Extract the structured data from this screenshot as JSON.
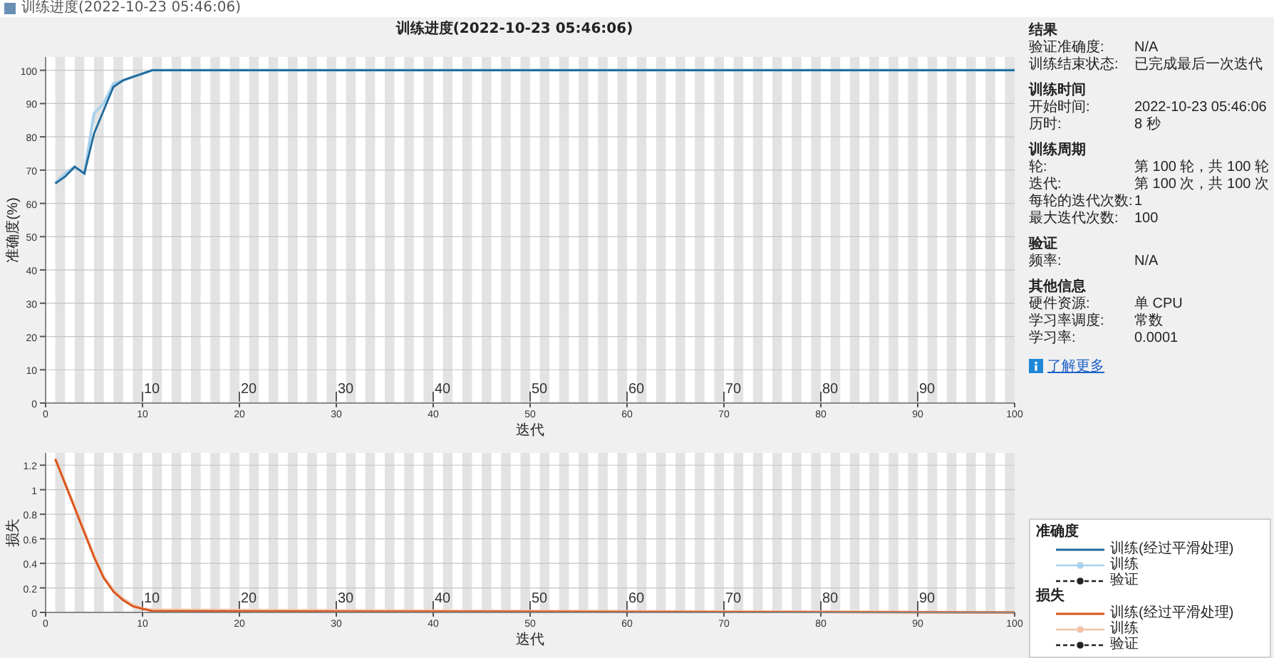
{
  "window": {
    "title": "训练进度(2022-10-23 05:46:06)"
  },
  "heading": "训练进度(2022-10-23 05:46:06)",
  "charts": [
    {
      "chart_data": {
        "type": "line",
        "xlabel": "迭代",
        "ylabel": "准确度(%)",
        "x": [
          1,
          2,
          3,
          4,
          5,
          6,
          7,
          8,
          9,
          10,
          11,
          100
        ],
        "xlim": [
          0,
          100
        ],
        "ylim": [
          0,
          104
        ],
        "xticks": [
          0,
          10,
          20,
          30,
          40,
          50,
          60,
          70,
          80,
          90,
          100
        ],
        "yticks": [
          0,
          10,
          20,
          30,
          40,
          50,
          60,
          70,
          80,
          90,
          100
        ],
        "grid": true,
        "series": [
          {
            "name": "训练(经过平滑处理)",
            "color": "#1f6a9a",
            "values": [
              66,
              68,
              71,
              69,
              81,
              88,
              95,
              97,
              98,
              99,
              100,
              100
            ]
          },
          {
            "name": "训练",
            "color": "#a9d1ec",
            "values": [
              66,
              69,
              71,
              69,
              87,
              90,
              96,
              97,
              98,
              99,
              100,
              100
            ]
          }
        ],
        "annotations": [
          "10",
          "20",
          "30",
          "40",
          "50",
          "60",
          "70",
          "80",
          "90"
        ]
      }
    },
    {
      "chart_data": {
        "type": "line",
        "xlabel": "迭代",
        "ylabel": "损失",
        "x": [
          1,
          2,
          3,
          4,
          5,
          6,
          7,
          8,
          9,
          10,
          11,
          100
        ],
        "xlim": [
          0,
          100
        ],
        "ylim": [
          0,
          1.3
        ],
        "xticks": [
          0,
          10,
          20,
          30,
          40,
          50,
          60,
          70,
          80,
          90,
          100
        ],
        "yticks": [
          0,
          0.2,
          0.4,
          0.6,
          0.8,
          1,
          1.2
        ],
        "grid": true,
        "series": [
          {
            "name": "训练(经过平滑处理)",
            "color": "#d95319",
            "values": [
              1.25,
              1.05,
              0.85,
              0.65,
              0.45,
              0.28,
              0.17,
              0.1,
              0.05,
              0.03,
              0.01,
              0
            ]
          },
          {
            "name": "训练",
            "color": "#f3c3a8",
            "values": [
              1.25,
              1.06,
              0.86,
              0.66,
              0.46,
              0.29,
              0.18,
              0.11,
              0.06,
              0.03,
              0.02,
              0
            ]
          }
        ],
        "annotations": [
          "10",
          "20",
          "30",
          "40",
          "50",
          "60",
          "70",
          "80",
          "90"
        ]
      }
    }
  ],
  "info": [
    {
      "title": "结果",
      "rows": [
        {
          "label": "验证准确度:",
          "value": "N/A"
        },
        {
          "label": "训练结束状态:",
          "value": "已完成最后一次迭代"
        }
      ]
    },
    {
      "title": "训练时间",
      "rows": [
        {
          "label": "开始时间:",
          "value": "2022-10-23 05:46:06"
        },
        {
          "label": "历时:",
          "value": "8 秒"
        }
      ]
    },
    {
      "title": "训练周期",
      "rows": [
        {
          "label": "轮:",
          "value": "第 100 轮，共 100 轮"
        },
        {
          "label": "迭代:",
          "value": "第 100 次，共 100 次"
        },
        {
          "label": "每轮的迭代次数:",
          "value": "1"
        },
        {
          "label": "最大迭代次数:",
          "value": "100"
        }
      ]
    },
    {
      "title": "验证",
      "rows": [
        {
          "label": "频率:",
          "value": "N/A"
        }
      ]
    },
    {
      "title": "其他信息",
      "rows": [
        {
          "label": "硬件资源:",
          "value": "单 CPU"
        },
        {
          "label": "学习率调度:",
          "value": "常数"
        },
        {
          "label": "学习率:",
          "value": "0.0001"
        }
      ]
    }
  ],
  "link": "了解更多",
  "legend": [
    {
      "title": "准确度",
      "validation": {
        "label": "验证",
        "color": "#222222"
      }
    },
    {
      "title": "损失",
      "validation": {
        "label": "验证",
        "color": "#222222"
      }
    }
  ]
}
